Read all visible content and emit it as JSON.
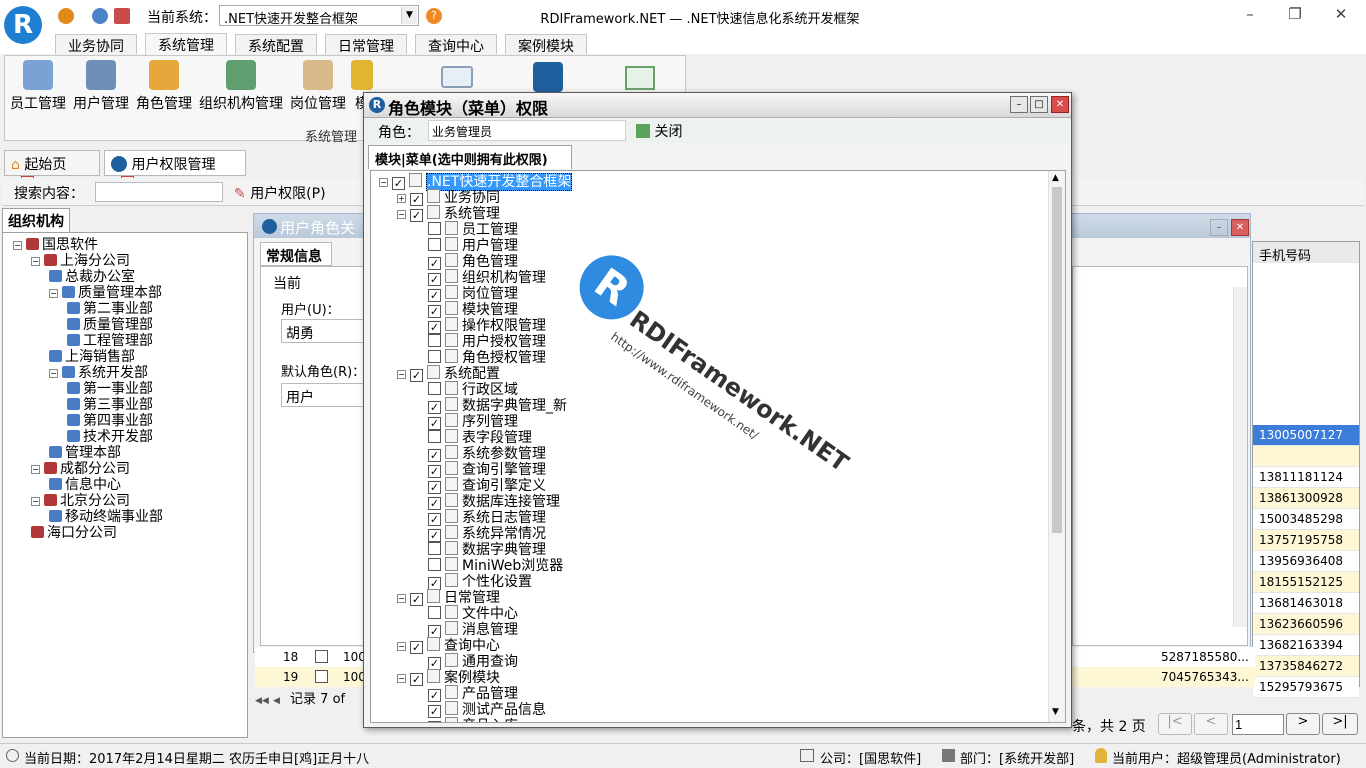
{
  "app": {
    "title": "RDIFramework.NET — .NET快速信息化系统开发框架",
    "current_system_label": "当前系统：",
    "current_system_value": ".NET快速开发整合框架"
  },
  "ribbon": {
    "tabs": [
      "业务协同",
      "系统管理",
      "系统配置",
      "日常管理",
      "查询中心",
      "案例模块"
    ],
    "active_tab": "系统管理",
    "buttons": [
      "员工管理",
      "用户管理",
      "角色管理",
      "组织机构管理",
      "岗位管理",
      "模"
    ],
    "group_label": "系统管理"
  },
  "doc_tabs": [
    "起始页",
    "用户权限管理"
  ],
  "search": {
    "label": "搜索内容：",
    "value": "",
    "permission_button": "用户权限(P)"
  },
  "left_panel": {
    "title": "组织机构",
    "tree": [
      {
        "label": "国思软件",
        "level": 0
      },
      {
        "label": "上海分公司",
        "level": 1
      },
      {
        "label": "总裁办公室",
        "level": 2
      },
      {
        "label": "质量管理本部",
        "level": 2
      },
      {
        "label": "第二事业部",
        "level": 3
      },
      {
        "label": "质量管理部",
        "level": 3
      },
      {
        "label": "工程管理部",
        "level": 3
      },
      {
        "label": "上海销售部",
        "level": 2
      },
      {
        "label": "系统开发部",
        "level": 2
      },
      {
        "label": "第一事业部",
        "level": 3
      },
      {
        "label": "第三事业部",
        "level": 3
      },
      {
        "label": "第四事业部",
        "level": 3
      },
      {
        "label": "技术开发部",
        "level": 3
      },
      {
        "label": "管理本部",
        "level": 2
      },
      {
        "label": "成都分公司",
        "level": 1
      },
      {
        "label": "信息中心",
        "level": 2
      },
      {
        "label": "北京分公司",
        "level": 1
      },
      {
        "label": "移动终端事业部",
        "level": 2
      },
      {
        "label": "海口分公司",
        "level": 1
      }
    ]
  },
  "back_window": {
    "title": "用户角色关",
    "tab": "常规信息",
    "section": "当前",
    "user_label": "用户(U)：",
    "user_value": "胡勇",
    "default_role_label": "默认角色(R)：",
    "default_role_value": "用户"
  },
  "grid": {
    "column": "手机号码",
    "phones": [
      "13005007127",
      "",
      "13811181124",
      "13861300928",
      "15003485298",
      "13757195758",
      "13956936408",
      "18155152125",
      "13681463018",
      "13623660596",
      "13682163394",
      "13735846272",
      "15295793675"
    ],
    "rows": [
      {
        "no": "18",
        "code": "100",
        "id": "5287185580..."
      },
      {
        "no": "19",
        "code": "100",
        "id": "7045765343..."
      }
    ],
    "record_text": "记录 7 of",
    "pager_text": "条，共 2 页",
    "page_input": "1"
  },
  "modal": {
    "title": "角色模块（菜单）权限",
    "role_label": "角色：",
    "role_value": "业务管理员",
    "close_label": "关闭",
    "tab": "模块|菜单(选中则拥有此权限)",
    "tree": [
      {
        "label": ".NET快速开发整合框架",
        "level": 0,
        "checked": true,
        "exp": "-"
      },
      {
        "label": "业务协同",
        "level": 1,
        "checked": true,
        "exp": "+"
      },
      {
        "label": "系统管理",
        "level": 1,
        "checked": true,
        "exp": "-"
      },
      {
        "label": "员工管理",
        "level": 2,
        "checked": false
      },
      {
        "label": "用户管理",
        "level": 2,
        "checked": false
      },
      {
        "label": "角色管理",
        "level": 2,
        "checked": true
      },
      {
        "label": "组织机构管理",
        "level": 2,
        "checked": true
      },
      {
        "label": "岗位管理",
        "level": 2,
        "checked": true
      },
      {
        "label": "模块管理",
        "level": 2,
        "checked": true
      },
      {
        "label": "操作权限管理",
        "level": 2,
        "checked": true
      },
      {
        "label": "用户授权管理",
        "level": 2,
        "checked": false
      },
      {
        "label": "角色授权管理",
        "level": 2,
        "checked": false
      },
      {
        "label": "系统配置",
        "level": 1,
        "checked": true,
        "exp": "-"
      },
      {
        "label": "行政区域",
        "level": 2,
        "checked": false
      },
      {
        "label": "数据字典管理_新",
        "level": 2,
        "checked": true
      },
      {
        "label": "序列管理",
        "level": 2,
        "checked": true
      },
      {
        "label": "表字段管理",
        "level": 2,
        "checked": false
      },
      {
        "label": "系统参数管理",
        "level": 2,
        "checked": true
      },
      {
        "label": "查询引擎管理",
        "level": 2,
        "checked": true
      },
      {
        "label": "查询引擎定义",
        "level": 2,
        "checked": true
      },
      {
        "label": "数据库连接管理",
        "level": 2,
        "checked": true
      },
      {
        "label": "系统日志管理",
        "level": 2,
        "checked": true
      },
      {
        "label": "系统异常情况",
        "level": 2,
        "checked": true
      },
      {
        "label": "数据字典管理",
        "level": 2,
        "checked": false
      },
      {
        "label": "MiniWeb浏览器",
        "level": 2,
        "checked": false
      },
      {
        "label": "个性化设置",
        "level": 2,
        "checked": true
      },
      {
        "label": "日常管理",
        "level": 1,
        "checked": true,
        "exp": "-"
      },
      {
        "label": "文件中心",
        "level": 2,
        "checked": false
      },
      {
        "label": "消息管理",
        "level": 2,
        "checked": true
      },
      {
        "label": "查询中心",
        "level": 1,
        "checked": true,
        "exp": "-"
      },
      {
        "label": "通用查询",
        "level": 2,
        "checked": true
      },
      {
        "label": "案例模块",
        "level": 1,
        "checked": true,
        "exp": "-"
      },
      {
        "label": "产品管理",
        "level": 2,
        "checked": true
      },
      {
        "label": "测试产品信息",
        "level": 2,
        "checked": true
      },
      {
        "label": "产品入库",
        "level": 2,
        "checked": true
      }
    ]
  },
  "watermark": {
    "brand": "RDIFramework.NET",
    "url": "http://www.rdiframework.net/"
  },
  "status": {
    "date": "当前日期：2017年2月14日星期二 农历壬申日[鸡]正月十八",
    "company": "公司：[国思软件]",
    "department": "部门：[系统开发部]",
    "user": "当前用户：超级管理员(Administrator)"
  },
  "colors": {
    "accent": "#1f7fd0",
    "highlight": "#3399ff",
    "grid_yellow": "#fdf7d6"
  }
}
